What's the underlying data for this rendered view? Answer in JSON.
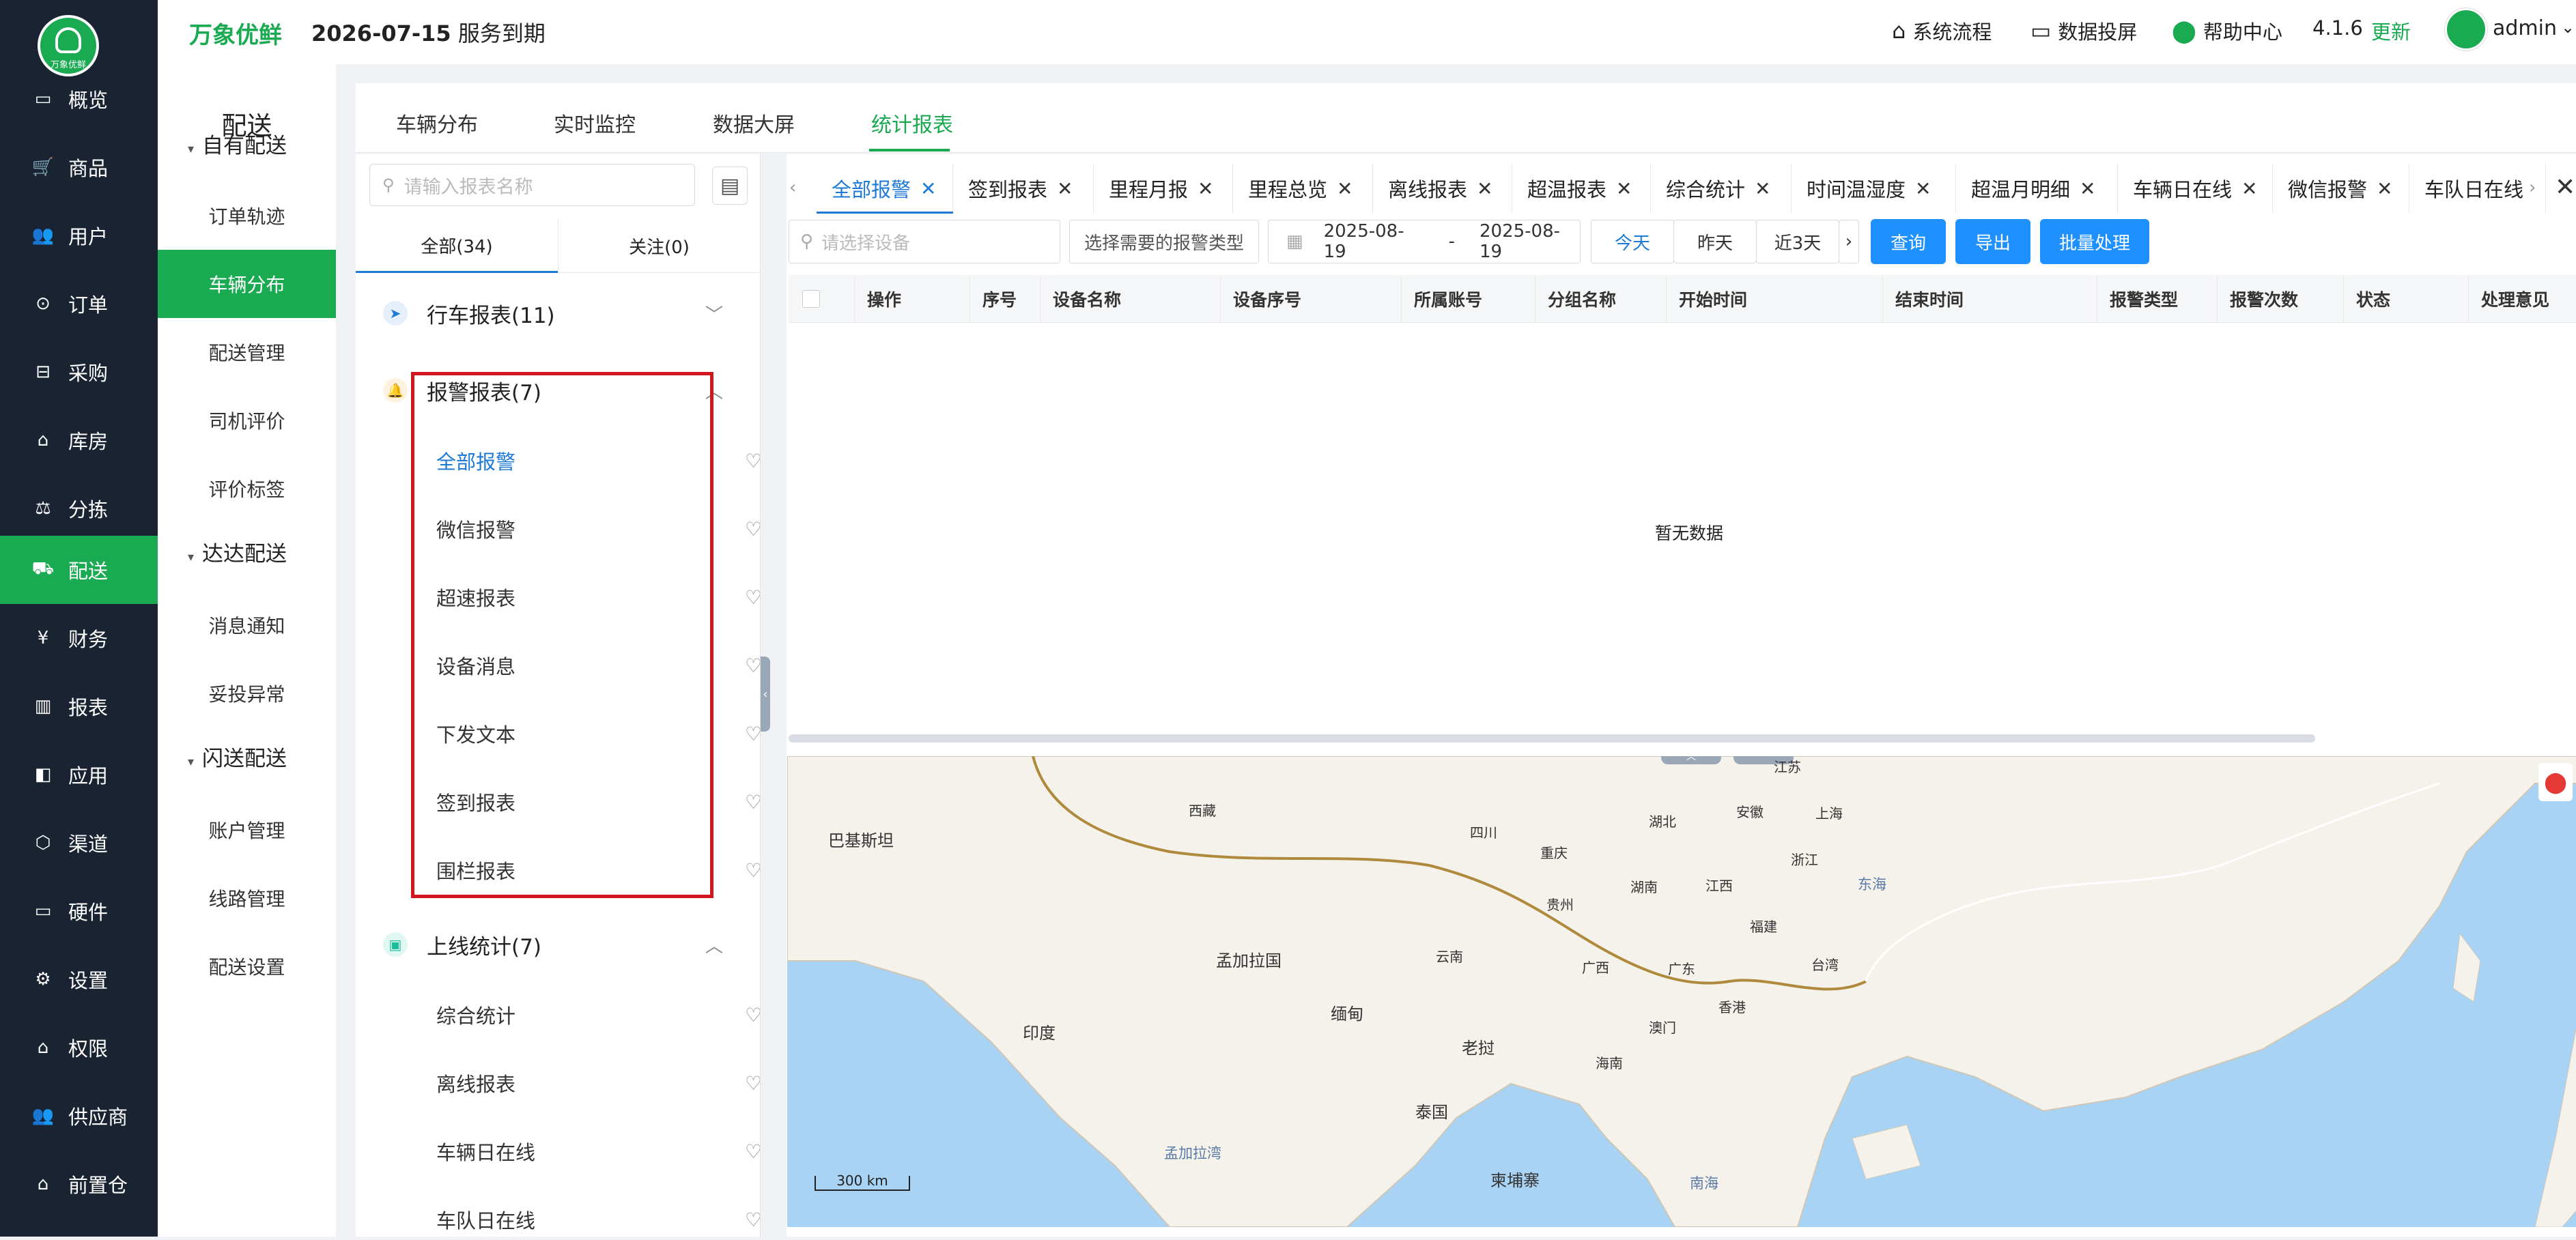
{
  "topbar": {
    "brand": "万象优鲜",
    "expiry_date": "2026-07-15",
    "expiry_text": "服务到期",
    "links": [
      {
        "label": "系统流程",
        "icon": "flow-icon"
      },
      {
        "label": "数据投屏",
        "icon": "monitor-icon"
      },
      {
        "label": "帮助中心",
        "icon": "location-icon"
      }
    ],
    "version": "4.1.6",
    "update": "更新",
    "user": "admin"
  },
  "logo": {
    "text": "万象优鲜"
  },
  "sidebar": {
    "items": [
      {
        "label": "概览",
        "icon": "monitor-icon"
      },
      {
        "label": "商品",
        "icon": "cart-icon"
      },
      {
        "label": "用户",
        "icon": "users-icon"
      },
      {
        "label": "订单",
        "icon": "order-icon"
      },
      {
        "label": "采购",
        "icon": "bus-icon"
      },
      {
        "label": "库房",
        "icon": "home-icon"
      },
      {
        "label": "分拣",
        "icon": "scale-icon"
      },
      {
        "label": "配送",
        "icon": "truck-icon"
      },
      {
        "label": "财务",
        "icon": "yen-icon"
      },
      {
        "label": "报表",
        "icon": "bar-chart-icon"
      },
      {
        "label": "应用",
        "icon": "apps-icon"
      },
      {
        "label": "渠道",
        "icon": "cube-icon"
      },
      {
        "label": "硬件",
        "icon": "desktop-icon"
      },
      {
        "label": "设置",
        "icon": "settings-icon"
      },
      {
        "label": "权限",
        "icon": "bank-icon"
      },
      {
        "label": "供应商",
        "icon": "supplier-icon"
      },
      {
        "label": "前置仓",
        "icon": "warehouse-icon"
      }
    ],
    "active": "配送"
  },
  "submenu": {
    "title": "配送",
    "groups": [
      {
        "label": "自有配送",
        "items": [
          "订单轨迹",
          "车辆分布",
          "配送管理",
          "司机评价",
          "评价标签"
        ]
      },
      {
        "label": "达达配送",
        "items": [
          "消息通知",
          "妥投异常"
        ]
      },
      {
        "label": "闪送配送",
        "items": [
          "账户管理",
          "线路管理",
          "配送设置"
        ]
      }
    ],
    "active": "车辆分布"
  },
  "main_tabs": [
    "车辆分布",
    "实时监控",
    "数据大屏",
    "统计报表"
  ],
  "main_tab_active": "统计报表",
  "report_panel": {
    "search_placeholder": "请输入报表名称",
    "filter_all": "全部(34)",
    "filter_follow": "关注(0)",
    "categories": [
      {
        "label": "行车报表(11)",
        "icon": "nav-arrow-icon",
        "expanded": false
      },
      {
        "label": "报警报表(7)",
        "icon": "bell-icon",
        "expanded": true,
        "items": [
          "全部报警",
          "微信报警",
          "超速报表",
          "设备消息",
          "下发文本",
          "签到报表",
          "围栏报表"
        ]
      },
      {
        "label": "上线统计(7)",
        "icon": "online-icon",
        "expanded": true,
        "items": [
          "综合统计",
          "离线报表",
          "车辆日在线",
          "车队日在线"
        ]
      }
    ],
    "active_item": "全部报警"
  },
  "report_tabs": [
    "全部报警",
    "签到报表",
    "里程月报",
    "里程总览",
    "离线报表",
    "超温报表",
    "综合统计",
    "时间温湿度",
    "超温月明细",
    "车辆日在线",
    "微信报警",
    "车队日在线"
  ],
  "report_tab_active": "全部报警",
  "filters": {
    "device_placeholder": "请选择设备",
    "alarm_type_placeholder": "选择需要的报警类型",
    "date_start": "2025-08-19",
    "date_sep": "-",
    "date_end": "2025-08-19",
    "quick": [
      "今天",
      "昨天",
      "近3天"
    ],
    "quick_active": "今天",
    "query": "查询",
    "export": "导出",
    "batch": "批量处理"
  },
  "table": {
    "columns": [
      "操作",
      "序号",
      "设备名称",
      "设备序号",
      "所属账号",
      "分组名称",
      "开始时间",
      "结束时间",
      "报警类型",
      "报警次数",
      "状态",
      "处理意见"
    ],
    "empty_text": "暂无数据"
  },
  "map": {
    "labels": [
      "西藏",
      "四川",
      "重庆",
      "湖北",
      "安徽",
      "江苏",
      "上海",
      "浙江",
      "湖南",
      "江西",
      "贵州",
      "福建",
      "东海",
      "云南",
      "广西",
      "广东",
      "台湾",
      "香港",
      "澳门",
      "海南",
      "巴基斯坦",
      "孟加拉国",
      "印度",
      "缅甸",
      "老挝",
      "泰国",
      "柬埔寨",
      "南海",
      "孟加拉湾"
    ],
    "scale": "300 km"
  }
}
